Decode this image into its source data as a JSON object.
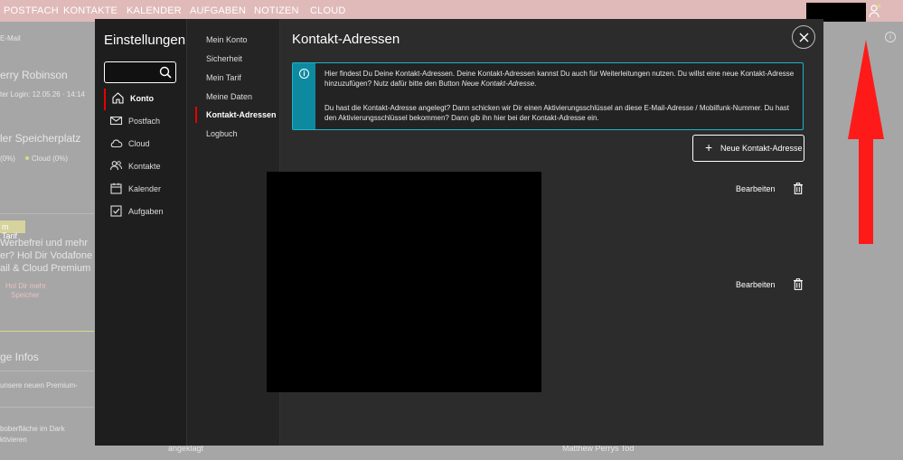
{
  "topnav": {
    "items": [
      "POSTFACH",
      "KONTAKTE",
      "KALENDER",
      "AUFGABEN",
      "NOTIZEN",
      "CLOUD"
    ]
  },
  "background": {
    "email_label": "E-Mail",
    "user_name": "erry Robinson",
    "last_login": "ter Login: 12.05.26 · 14:14",
    "storage_title": "ler Speicherplatz",
    "storage_legend_a": "(0%)",
    "storage_legend_b": "Cloud (0%)",
    "tariff_tab": "m Tarif",
    "promo_l1": "Werbefrei und mehr",
    "promo_l2": "er? Hol Dir Vodafone",
    "promo_l3": "ail & Cloud Premium",
    "promo_btn_l1": "Hol Dir mehr",
    "promo_btn_l2": "Speicher",
    "infos_title": "ge Infos",
    "info_item1": "unsere neuen Premium-",
    "info_item2_l1": "boberfläche im Dark",
    "info_item2_l2": "ktivieren",
    "bottom_text1": "angeklagt",
    "bottom_text2": "Matthew Perrys Tod"
  },
  "settings": {
    "title": "Einstellungen",
    "search": {
      "value": "",
      "placeholder": ""
    },
    "categories": [
      {
        "label": "Konto",
        "icon": "home-icon"
      },
      {
        "label": "Postfach",
        "icon": "mail-icon"
      },
      {
        "label": "Cloud",
        "icon": "cloud-icon"
      },
      {
        "label": "Kontakte",
        "icon": "contacts-icon"
      },
      {
        "label": "Kalender",
        "icon": "calendar-icon"
      },
      {
        "label": "Aufgaben",
        "icon": "tasks-icon"
      }
    ],
    "subnav": [
      "Mein Konto",
      "Sicherheit",
      "Mein Tarif",
      "Meine Daten",
      "Kontakt-Adressen",
      "Logbuch"
    ]
  },
  "main": {
    "title": "Kontakt-Adressen",
    "info_p1": "Hier findest Du Deine Kontakt-Adressen. Deine Kontakt-Adressen kannst Du auch für Weiterleitungen nutzen. Du willst eine neue Kontakt-Adresse hinzuzufügen? Nutz dafür bitte den Button ",
    "info_p1_em": "Neue Kontakt-Adresse",
    "info_p1_end": ".",
    "info_p2": "Du hast die Kontakt-Adresse angelegt? Dann schicken wir Dir einen Aktivierungsschlüssel an diese E-Mail-Adresse / Mobilfunk-Nummer. Du hast den Aktivierungsschlüssel bekommen? Dann gib ihn hier bei der Kontakt-Adresse ein.",
    "new_button": "Neue Kontakt-Adresse",
    "rows": [
      {
        "edit": "Bearbeiten"
      },
      {
        "edit": "Bearbeiten"
      }
    ]
  },
  "colors": {
    "accent": "#e60000",
    "info": "#1fb4c6",
    "arrow": "#ff1a1a"
  }
}
